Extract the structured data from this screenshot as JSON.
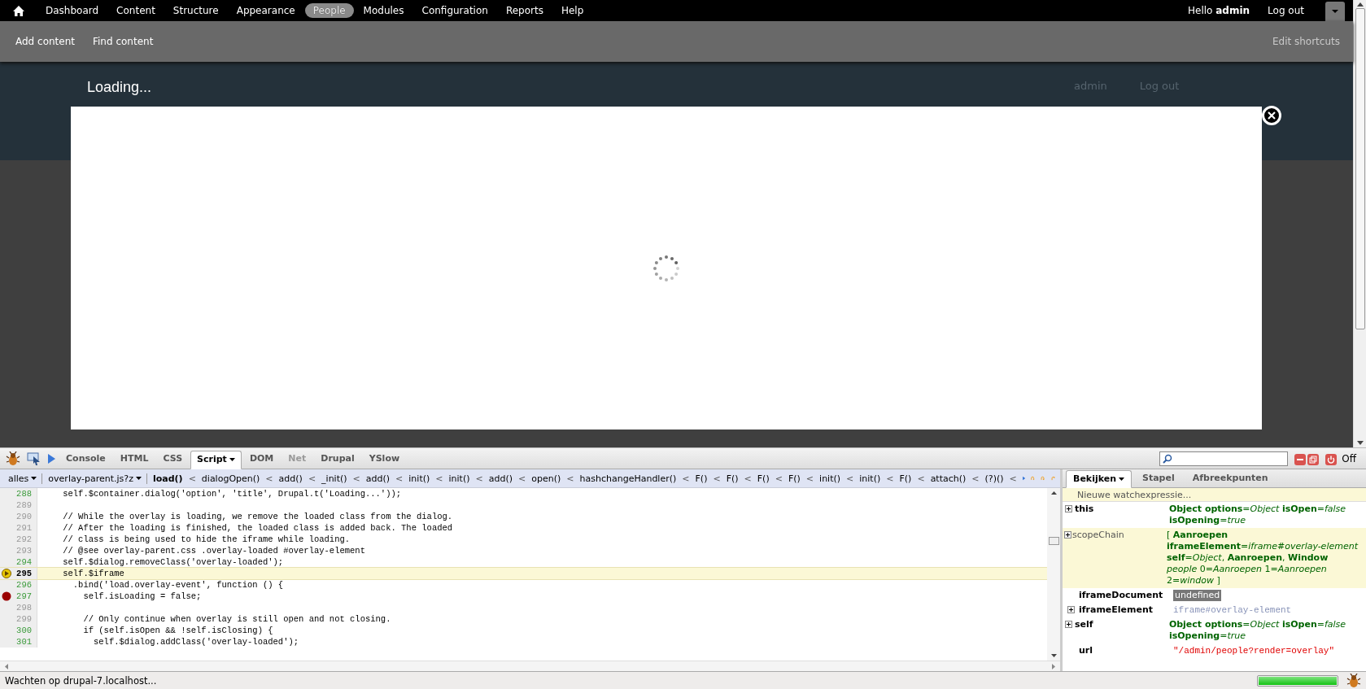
{
  "toolbar": {
    "nav": [
      {
        "label": "Dashboard",
        "selected": false
      },
      {
        "label": "Content",
        "selected": false
      },
      {
        "label": "Structure",
        "selected": false
      },
      {
        "label": "Appearance",
        "selected": false
      },
      {
        "label": "People",
        "selected": true
      },
      {
        "label": "Modules",
        "selected": false
      },
      {
        "label": "Configuration",
        "selected": false
      },
      {
        "label": "Reports",
        "selected": false
      },
      {
        "label": "Help",
        "selected": false
      }
    ],
    "greeting": "Hello **admin**",
    "logout": "Log out"
  },
  "shortcuts": {
    "items": [
      "Add content",
      "Find content"
    ],
    "edit": "Edit shortcuts"
  },
  "page_header": {
    "links": [
      "admin",
      "Log out"
    ]
  },
  "overlay": {
    "title": "Loading..."
  },
  "firebug": {
    "tabs": [
      {
        "label": "Console",
        "selected": false,
        "disabled": false
      },
      {
        "label": "HTML",
        "selected": false,
        "disabled": false
      },
      {
        "label": "CSS",
        "selected": false,
        "disabled": false
      },
      {
        "label": "Script",
        "selected": true,
        "disabled": false
      },
      {
        "label": "DOM",
        "selected": false,
        "disabled": false
      },
      {
        "label": "Net",
        "selected": false,
        "disabled": true
      },
      {
        "label": "Drupal",
        "selected": false,
        "disabled": false
      },
      {
        "label": "YSlow",
        "selected": false,
        "disabled": false
      }
    ],
    "power": "Off",
    "location": {
      "filter": "alles",
      "file": "overlay-parent.js?z",
      "separator": "<",
      "frames": [
        {
          "label": "load()",
          "selected": true
        },
        {
          "label": "dialogOpen()",
          "selected": false
        },
        {
          "label": "add()",
          "selected": false
        },
        {
          "label": "_init()",
          "selected": false
        },
        {
          "label": "add()",
          "selected": false
        },
        {
          "label": "init()",
          "selected": false
        },
        {
          "label": "init()",
          "selected": false
        },
        {
          "label": "add()",
          "selected": false
        },
        {
          "label": "open()",
          "selected": false
        },
        {
          "label": "hashchangeHandler()",
          "selected": false
        },
        {
          "label": "F()",
          "selected": false
        },
        {
          "label": "F()",
          "selected": false
        },
        {
          "label": "F()",
          "selected": false
        },
        {
          "label": "F()",
          "selected": false
        },
        {
          "label": "init()",
          "selected": false
        },
        {
          "label": "init()",
          "selected": false
        },
        {
          "label": "F()",
          "selected": false
        },
        {
          "label": "attach()",
          "selected": false
        },
        {
          "label": "(?)()",
          "selected": false
        }
      ]
    },
    "code": [
      {
        "number": "288",
        "text": "    self.$container.dialog('option', 'title', Drupal.t('Loading...'));",
        "executable": true,
        "current": false,
        "breakpoint": false
      },
      {
        "number": "289",
        "executable": false,
        "current": false,
        "breakpoint": false
      },
      {
        "number": "290",
        "text": "    // While the overlay is loading, we remove the loaded class from the dialog.",
        "executable": false,
        "current": false,
        "breakpoint": false
      },
      {
        "number": "291",
        "text": "    // After the loading is finished, the loaded class is added back. The loaded",
        "executable": false,
        "current": false,
        "breakpoint": false
      },
      {
        "number": "292",
        "text": "    // class is being used to hide the iframe while loading.",
        "executable": false,
        "current": false,
        "breakpoint": false
      },
      {
        "number": "293",
        "text": "    // @see overlay-parent.css .overlay-loaded #overlay-element",
        "executable": false,
        "current": false,
        "breakpoint": false
      },
      {
        "number": "294",
        "text": "    self.$dialog.removeClass('overlay-loaded');",
        "executable": true,
        "current": false,
        "breakpoint": false
      },
      {
        "number": "295",
        "text": "    self.$iframe",
        "executable": true,
        "current": true,
        "breakpoint": false
      },
      {
        "number": "296",
        "text": "      .bind('load.overlay-event', function () {",
        "executable": true,
        "current": false,
        "breakpoint": false
      },
      {
        "number": "297",
        "text": "        self.isLoading = false;",
        "executable": true,
        "current": false,
        "breakpoint": true
      },
      {
        "number": "298",
        "executable": false,
        "current": false,
        "breakpoint": false
      },
      {
        "number": "299",
        "text": "        // Only continue when overlay is still open and not closing.",
        "executable": false,
        "current": false,
        "breakpoint": false
      },
      {
        "number": "300",
        "text": "        if (self.isOpen && !self.isClosing) {",
        "executable": true,
        "current": false,
        "breakpoint": false
      },
      {
        "number": "301",
        "text": "          self.$dialog.addClass('overlay-loaded');",
        "executable": true,
        "current": false,
        "breakpoint": false
      }
    ],
    "side_tabs": [
      {
        "label": "Bekijken",
        "selected": true
      },
      {
        "label": "Stapel",
        "selected": false
      },
      {
        "label": "Afbreekpunten",
        "selected": false
      }
    ],
    "new_watch": "Nieuwe watchexpressie...",
    "watches": [
      {
        "name": "this",
        "kind": "object",
        "expandable": true,
        "changed": false,
        "internal": false,
        "value": "**Object options**=*Object* **isOpen**=*false* **isOpening**=*true*"
      },
      {
        "name": "scopeChain",
        "kind": "object",
        "expandable": true,
        "changed": true,
        "internal": true,
        "value": "[ **Aanroepen iframeElement**=*iframe#overlay-element* **self**=*Object*,  **Aanroepen**,  **Window** *people* 0=*Aanroepen* 1=*Aanroepen* 2=*window* ]"
      },
      {
        "name": "iframeDocument",
        "kind": "undefined",
        "expandable": false,
        "changed": false,
        "internal": false,
        "value": "undefined"
      },
      {
        "name": "iframeElement",
        "kind": "element",
        "expandable": true,
        "changed": false,
        "internal": false,
        "value": "iframe#overlay-element"
      },
      {
        "name": "self",
        "kind": "object",
        "expandable": true,
        "changed": false,
        "internal": false,
        "value": "**Object options**=*Object* **isOpen**=*false* **isOpening**=*true*"
      },
      {
        "name": "url",
        "kind": "string",
        "expandable": false,
        "changed": false,
        "internal": false,
        "value": "\"/admin/people?render=overlay\""
      }
    ]
  },
  "status_bar": {
    "text": "Wachten op drupal-7.localhost...",
    "progress": {
      "level": 1
    }
  }
}
